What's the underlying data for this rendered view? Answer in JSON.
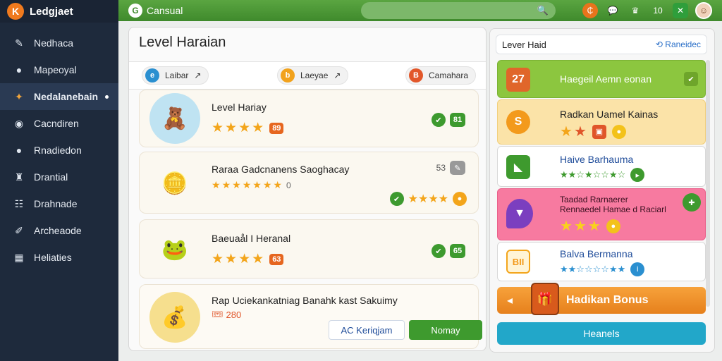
{
  "app": {
    "title": "Ledgjaet",
    "logo_glyph": "K"
  },
  "sidebar": {
    "items": [
      {
        "label": "Nedhaca",
        "icon": "pin-icon",
        "glyph": "✎",
        "active": false
      },
      {
        "label": "Mapeoyal",
        "icon": "person-icon",
        "glyph": "●",
        "active": false
      },
      {
        "label": "Nedalanebain",
        "icon": "treasure-icon",
        "glyph": "✦",
        "active": true
      },
      {
        "label": "Cacndiren",
        "icon": "user-group-icon",
        "glyph": "◉",
        "active": false
      },
      {
        "label": "Rnadiedon",
        "icon": "chat-icon",
        "glyph": "●",
        "active": false
      },
      {
        "label": "Drantial",
        "icon": "trophy-icon",
        "glyph": "♜",
        "active": false
      },
      {
        "label": "Drahnade",
        "icon": "list-icon",
        "glyph": "☷",
        "active": false
      },
      {
        "label": "Archeaode",
        "icon": "edit-icon",
        "glyph": "✐",
        "active": false
      },
      {
        "label": "Heliaties",
        "icon": "grid-icon",
        "glyph": "▦",
        "active": false
      }
    ]
  },
  "topbar": {
    "section": "Cansual",
    "search_icon": "🔍",
    "icons": [
      {
        "name": "coin-icon",
        "glyph": "₵",
        "color": "#e8741c"
      },
      {
        "name": "chat-bubble-icon",
        "glyph": "💬",
        "color": "#3f8a2c"
      },
      {
        "name": "trophy-icon",
        "glyph": "♛",
        "color": "#3f8a2c"
      },
      {
        "name": "score-icon",
        "glyph": "10",
        "color": "#3f8a2c"
      },
      {
        "name": "expand-icon",
        "glyph": "✕",
        "color": "#2f9e3b"
      }
    ]
  },
  "main": {
    "title": "Level Haraian",
    "filters": [
      {
        "label": "Laibar",
        "glyph": "e",
        "color": "#2a8fd0",
        "arrow": "↗"
      },
      {
        "label": "Laeyae",
        "glyph": "b",
        "color": "#f2a21c",
        "arrow": "↗"
      },
      {
        "label": "Camahara",
        "glyph": "B",
        "color": "#e2572a",
        "arrow": ""
      }
    ],
    "cards": [
      {
        "title": "Level Hariay",
        "stars": 4,
        "badge": "89",
        "right_value": "81",
        "icon": "🧸"
      },
      {
        "title": "Raraa Gadcnanens Saoghacay",
        "stars": 7,
        "rating_extra": "0",
        "right_value": "53",
        "second_stars": 4,
        "icon": "🪙"
      },
      {
        "title": "Baeuaål I Heranal",
        "stars": 4,
        "badge": "63",
        "right_value": "65",
        "icon": "🐸"
      },
      {
        "title": "Rap Uciekankatniag Banahk kast Sakuimy",
        "price": "280",
        "icon": "💰"
      }
    ],
    "buttons": {
      "outline": "AC Keriqjam",
      "primary": "Nomay"
    }
  },
  "right": {
    "header": "Lever Haid",
    "header_link": "Raneidec",
    "levels": [
      {
        "title": "Haegeil Aemn eonan",
        "icon_text": "27",
        "bg": "#8cc63f",
        "icon_bg": "#e0662a"
      },
      {
        "title": "Radkan Uamel Kainas",
        "icon_text": "S",
        "bg": "#fbe3a8",
        "icon_bg": "#f39a1c"
      },
      {
        "title": "Haive Barhauma",
        "icon_text": "◣",
        "bg": "#ffffff",
        "icon_bg": "#3e9a2e"
      },
      {
        "title": "Taadad Rarnaerer",
        "subtitle": "Rennaedel Hamae d Raciarl",
        "icon_text": "▼",
        "bg": "#f77aa0",
        "icon_bg": "#7b3fbf"
      },
      {
        "title": "Balva Bermanna",
        "icon_text": "BII",
        "bg": "#ffffff",
        "icon_bg": "#f3a51b"
      }
    ],
    "bonus_label": "Hadikan Bonus",
    "bottom_button": "Heanels"
  }
}
